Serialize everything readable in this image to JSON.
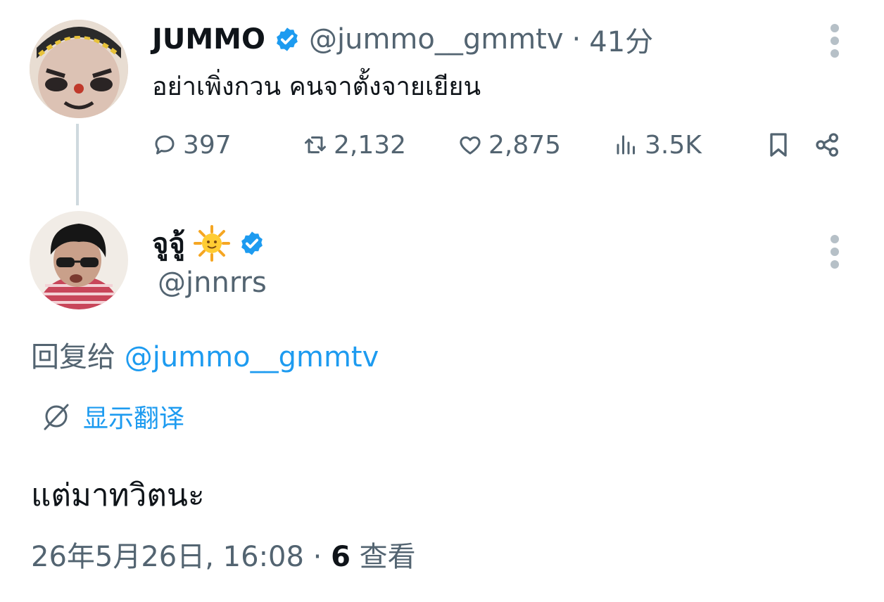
{
  "parent_tweet": {
    "display_name": "JUMMO",
    "handle": "@jummo__gmmtv",
    "separator": "·",
    "time_ago": "41分",
    "text": "อย่าเพิ่งกวน คนจาตั้งจายเยียน",
    "actions": {
      "replies": "397",
      "retweets": "2,132",
      "likes": "2,875",
      "views": "3.5K"
    }
  },
  "reply_tweet": {
    "display_name": "จูจู้",
    "name_emoji": "🌞",
    "handle": "@jnnrrs",
    "reply_to_prefix": "回复给",
    "reply_to_handle": "@jummo__gmmtv",
    "translate_label": "显示翻译",
    "text": "แต่มาทวิตนะ",
    "timestamp": "26年5月26日, 16:08",
    "separator": "·",
    "views_count": "6",
    "views_label": "查看"
  },
  "colors": {
    "accent": "#1d9bf0",
    "secondary_text": "#536471",
    "primary_text": "#0f1419",
    "thread_line": "#cfd9de"
  },
  "icons": {
    "verified": "verified-badge-icon",
    "more": "more-vertical-icon",
    "reply": "reply-bubble-icon",
    "retweet": "retweet-icon",
    "like": "heart-icon",
    "views": "views-bar-icon",
    "bookmark": "bookmark-icon",
    "share": "share-icon",
    "translate": "translate-globe-icon"
  }
}
